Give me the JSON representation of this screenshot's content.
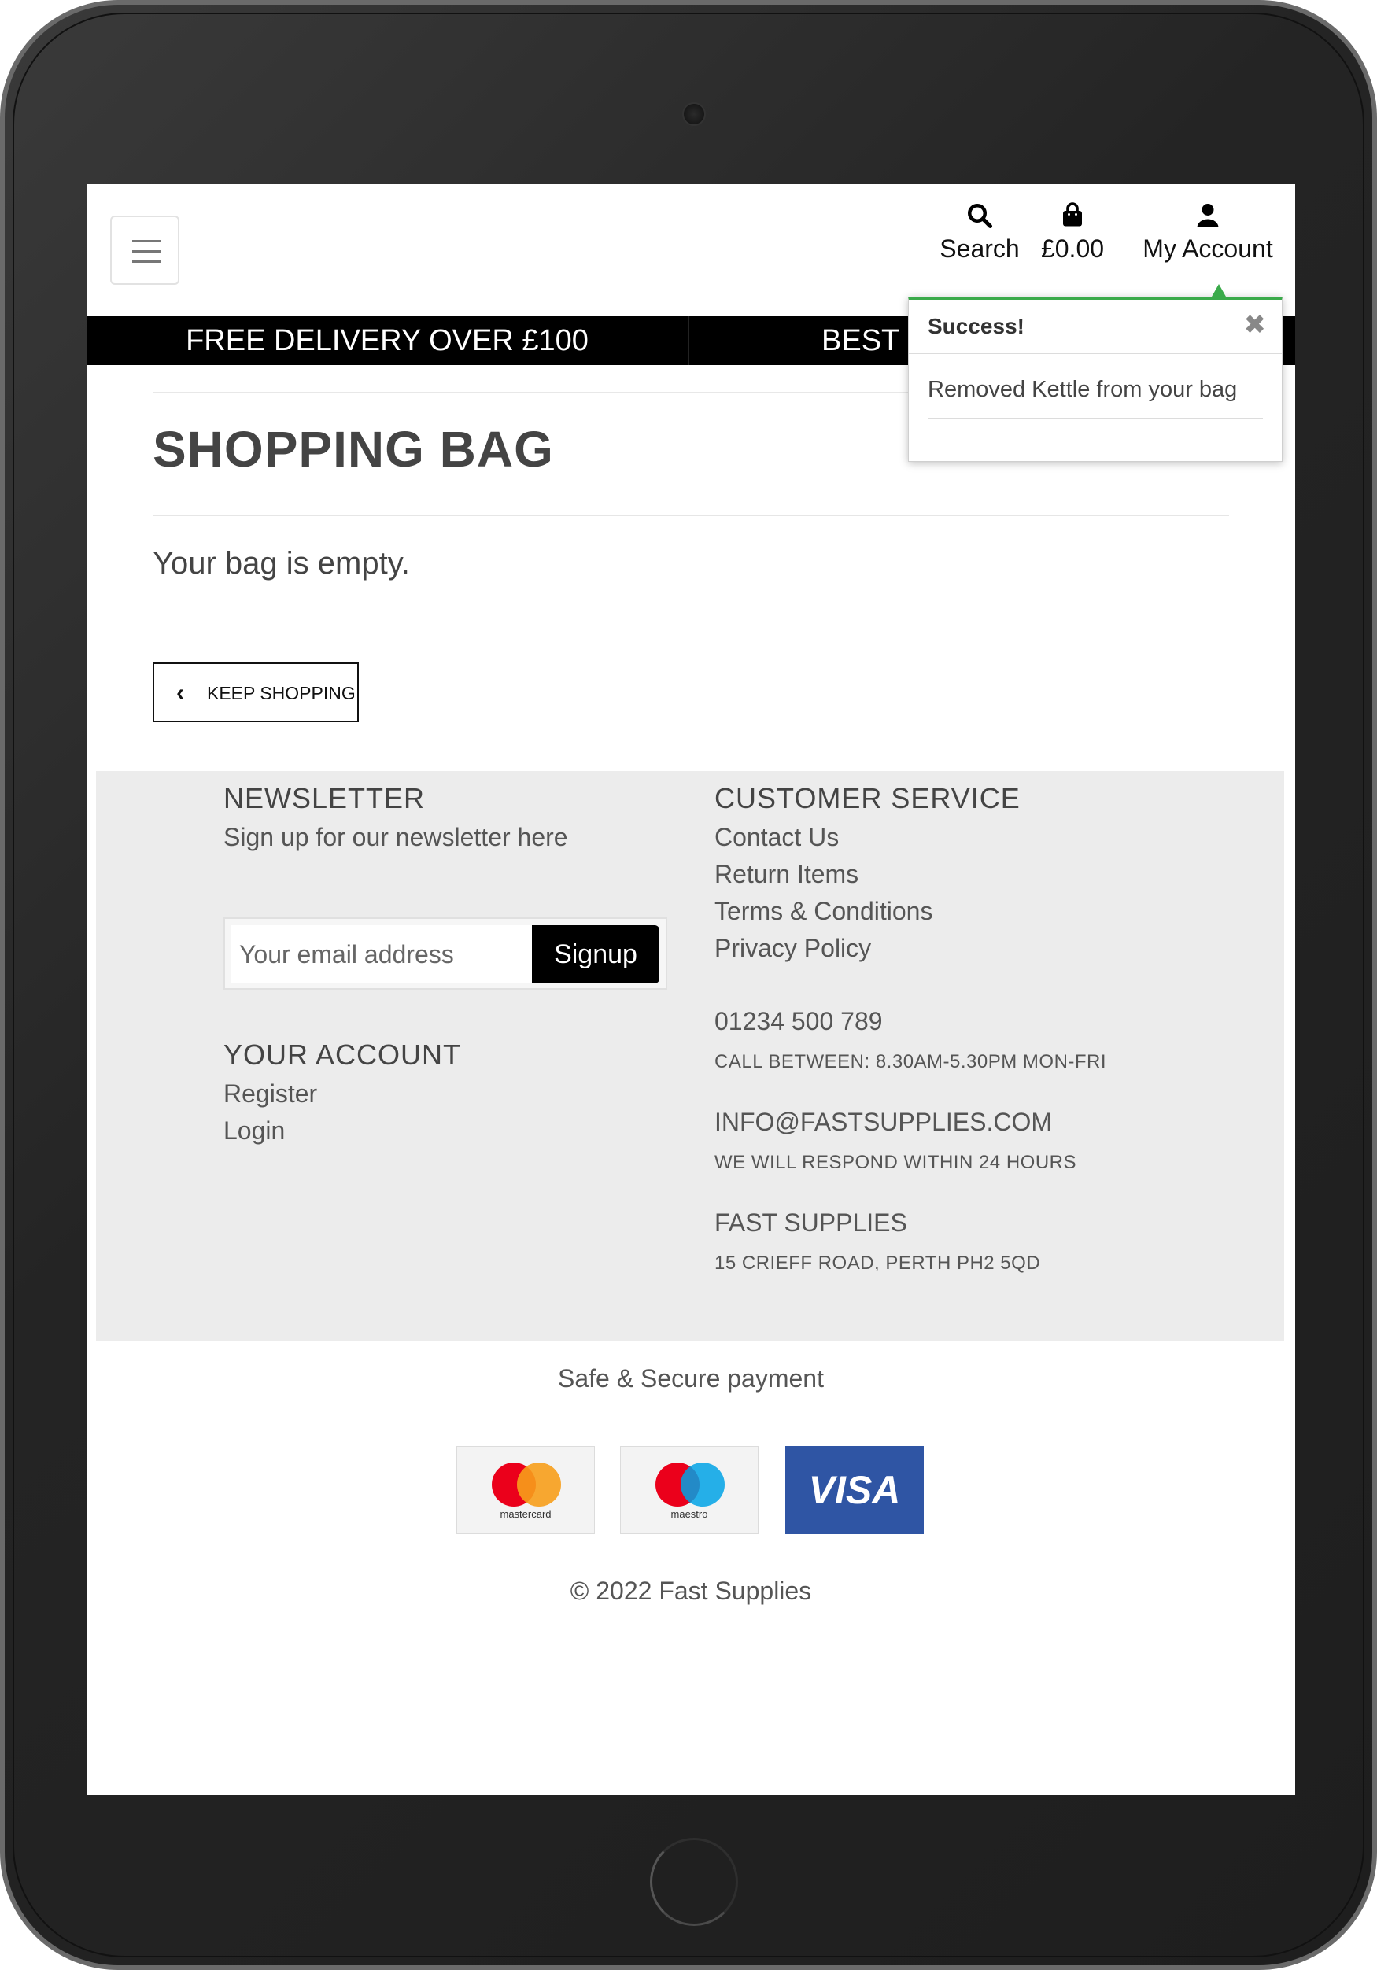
{
  "header": {
    "search_label": "Search",
    "bag_total": "£0.00",
    "account_label": "My Account"
  },
  "promo": {
    "left": "FREE DELIVERY OVER £100",
    "right": "BEST F"
  },
  "toast": {
    "title": "Success!",
    "close_glyph": "✖",
    "message": "Removed Kettle from your bag",
    "accent_color": "#3aaa4a"
  },
  "main": {
    "title": "SHOPPING BAG",
    "empty_message": "Your bag is empty.",
    "keep_shopping_label": "KEEP SHOPPING"
  },
  "footer": {
    "newsletter": {
      "heading": "NEWSLETTER",
      "text": "Sign up for our newsletter here",
      "email_placeholder": "Your email address",
      "signup_label": "Signup"
    },
    "account": {
      "heading": "YOUR ACCOUNT",
      "links": [
        "Register",
        "Login"
      ]
    },
    "customer_service": {
      "heading": "CUSTOMER SERVICE",
      "links": [
        "Contact Us",
        "Return Items",
        "Terms & Conditions",
        "Privacy Policy"
      ],
      "phone": "01234 500 789",
      "phone_note": "CALL BETWEEN: 8.30AM-5.30PM MON-FRI",
      "email": "INFO@FASTSUPPLIES.COM",
      "email_note": "WE WILL RESPOND WITHIN 24 HOURS",
      "company": "FAST SUPPLIES",
      "address": "15 CRIEFF ROAD, PERTH PH2 5QD"
    }
  },
  "payment": {
    "title": "Safe & Secure payment",
    "cards": [
      {
        "name": "mastercard",
        "caption": "mastercard"
      },
      {
        "name": "maestro",
        "caption": "maestro"
      },
      {
        "name": "visa",
        "caption": "VISA"
      }
    ]
  },
  "copyright": "© 2022 Fast Supplies"
}
